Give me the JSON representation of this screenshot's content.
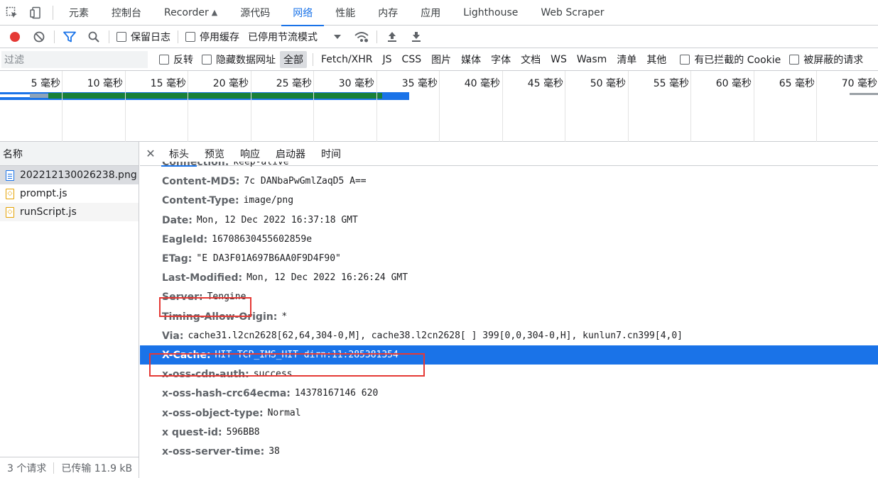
{
  "top_tabs": [
    "元素",
    "控制台",
    "Recorder",
    "源代码",
    "网络",
    "性能",
    "内存",
    "应用",
    "Lighthouse",
    "Web Scraper"
  ],
  "active_top_tab": "网络",
  "toolbar": {
    "preserve_log": "保留日志",
    "disable_cache": "停用缓存",
    "throttling": "已停用节流模式"
  },
  "filter": {
    "placeholder": "过滤",
    "invert": "反转",
    "hide_data_urls": "隐藏数据网址",
    "types": [
      "全部",
      "Fetch/XHR",
      "JS",
      "CSS",
      "图片",
      "媒体",
      "字体",
      "文档",
      "WS",
      "Wasm",
      "清单",
      "其他"
    ],
    "blocked_cookies": "有已拦截的 Cookie",
    "blocked_requests": "被屏蔽的请求"
  },
  "timeline": {
    "ticks": [
      "5 毫秒",
      "10 毫秒",
      "15 毫秒",
      "20 毫秒",
      "25 毫秒",
      "30 毫秒",
      "35 毫秒",
      "40 毫秒",
      "45 毫秒",
      "50 毫秒",
      "55 毫秒",
      "60 毫秒",
      "65 毫秒",
      "70 毫秒"
    ]
  },
  "requests": {
    "header": "名称",
    "items": [
      "202212130026238.png",
      "prompt.js",
      "runScript.js"
    ],
    "footer_count": "3 个请求",
    "footer_transferred": "已传输 11.9 kB"
  },
  "detail_tabs": [
    "标头",
    "预览",
    "响应",
    "启动器",
    "时间"
  ],
  "headers": [
    {
      "k": "Connection:",
      "v": "keep-alive"
    },
    {
      "k": "Content-MD5:",
      "v": "7c  DANbaPwGmlZaqD5  A=="
    },
    {
      "k": "Content-Type:",
      "v": "image/png"
    },
    {
      "k": "Date:",
      "v": "Mon, 12 Dec 2022 16:37:18 GMT"
    },
    {
      "k": "EagleId:",
      "v": "16708630455602859e"
    },
    {
      "k": "ETag:",
      "v": "\"E  DA3F01A697B6AA0F9D4F90\""
    },
    {
      "k": "Last-Modified:",
      "v": "Mon, 12 Dec 2022 16:26:24 GMT"
    },
    {
      "k": "Server:",
      "v": "Tengine"
    },
    {
      "k": "Timing-Allow-Origin:",
      "v": "*"
    },
    {
      "k": "Via:",
      "v": "cache31.l2cn2628[62,64,304-0,M], cache38.l2cn2628[  ]  399[0,0,304-0,H], kunlun7.cn399[4,0]"
    },
    {
      "k": "X-Cache:",
      "v": "HIT TCP_IMS_HIT dirn:11:285381354"
    },
    {
      "k": "x-oss-cdn-auth:",
      "v": "success"
    },
    {
      "k": "x-oss-hash-crc64ecma:",
      "v": "14378167146  620"
    },
    {
      "k": "x-oss-object-type:",
      "v": "Normal"
    },
    {
      "k": "x  quest-id:",
      "v": "  596BB8"
    },
    {
      "k": "x-oss-server-time:",
      "v": "38"
    }
  ],
  "colors": {
    "accent": "#1a73e8",
    "highlight_box": "#e53935",
    "record": "#e53935"
  }
}
